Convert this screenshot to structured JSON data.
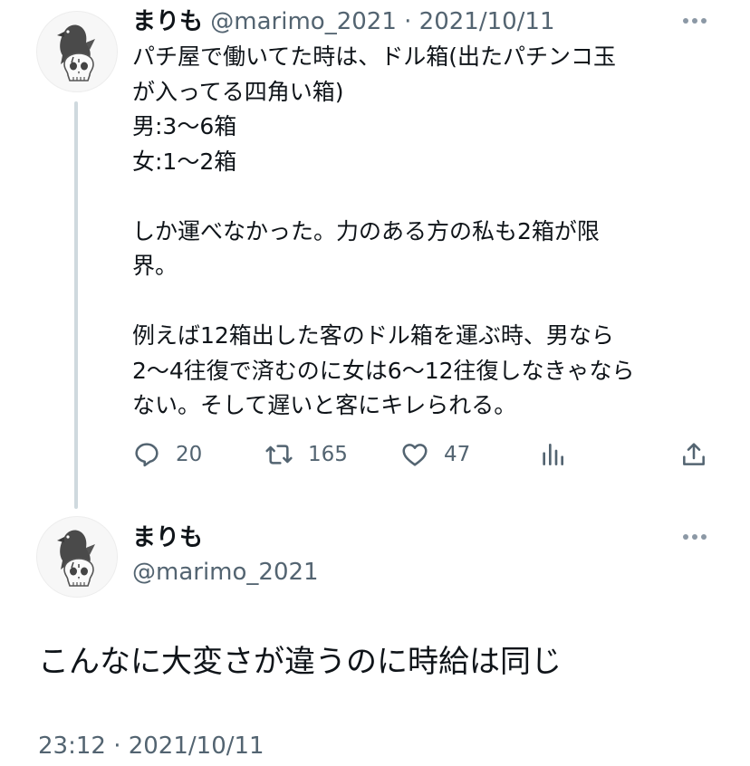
{
  "tweet1": {
    "display_name": "まりも",
    "handle": "@marimo_2021",
    "separator": "·",
    "date": "2021/10/11",
    "body": "パチ屋で働いてた時は、ドル箱(出たパチンコ玉\nが入ってる四角い箱)\n男:3〜6箱\n女:1〜2箱\n\nしか運べなかった。力のある方の私も2箱が限\n界。\n\n例えば12箱出した客のドル箱を運ぶ時、男なら\n2〜4往復で済むのに女は6〜12往復しなきゃなら\nない。そして遅いと客にキレられる。",
    "actions": {
      "reply_count": "20",
      "retweet_count": "165",
      "like_count": "47"
    }
  },
  "tweet2": {
    "display_name": "まりも",
    "handle": "@marimo_2021",
    "body": "こんなに大変さが違うのに時給は同じ",
    "timestamp": "23:12 · 2021/10/11"
  },
  "icons": {
    "avatar": "crow-on-skull-avatar",
    "more": "more-dots-icon",
    "reply": "reply-icon",
    "retweet": "retweet-icon",
    "like": "heart-icon",
    "views": "analytics-icon",
    "share": "share-icon"
  },
  "colors": {
    "text": "#0f1419",
    "secondary": "#536471",
    "thread_line": "#cfd9de"
  }
}
